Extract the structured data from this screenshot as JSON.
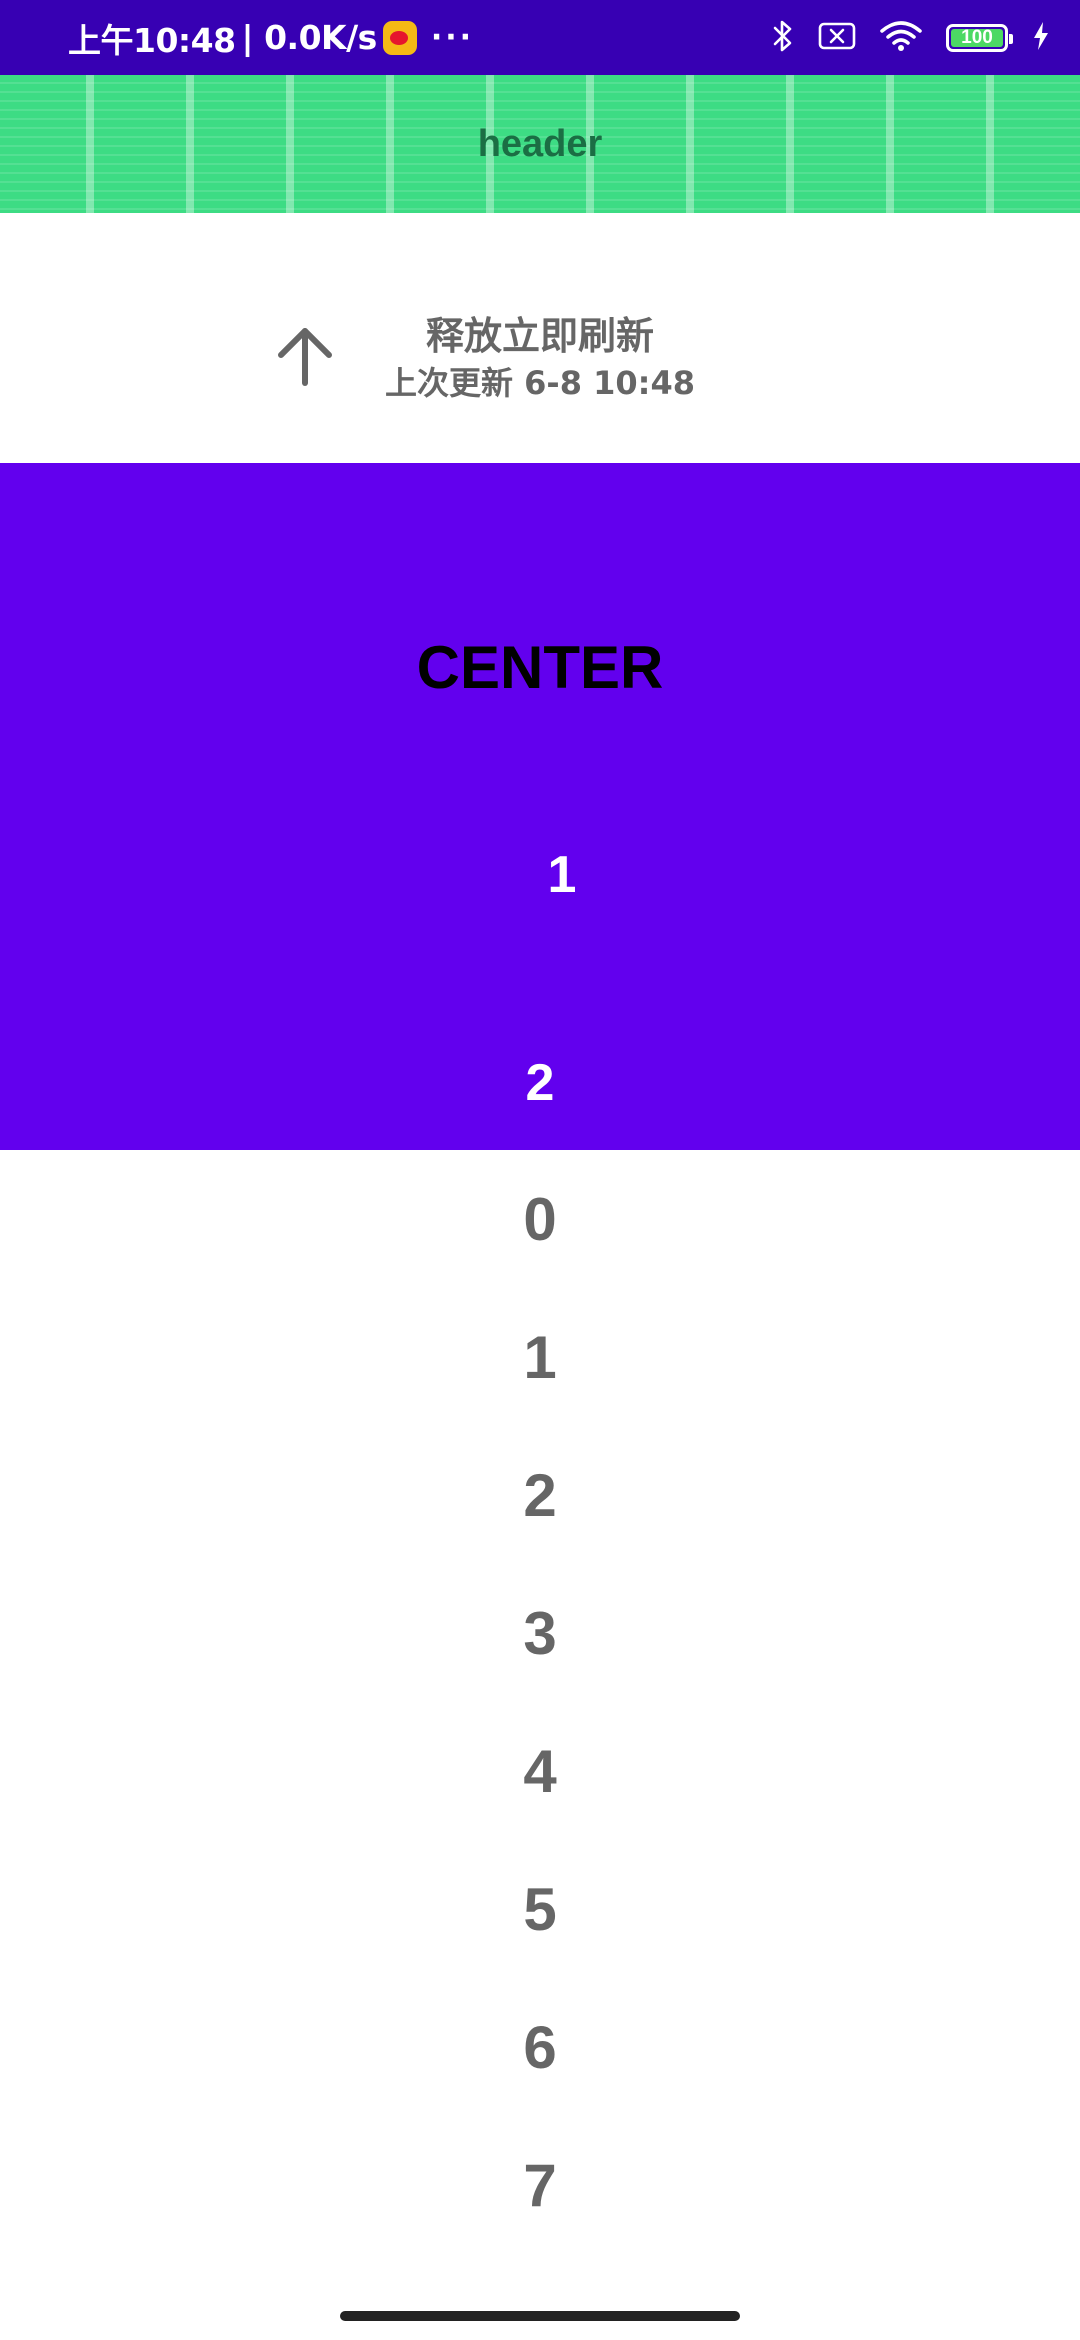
{
  "status_bar": {
    "time": "上午10:48",
    "network_speed": "| 0.0K/s",
    "app_icon": "weibo-icon",
    "more": "···",
    "icons": [
      "bluetooth-icon",
      "no-sim-icon",
      "wifi-icon",
      "battery-icon",
      "charging-icon"
    ],
    "battery_level": "100",
    "battery_fraction": 1.0,
    "background_color": "#3700b3"
  },
  "header": {
    "title": "header",
    "background_color": "#3ddc84"
  },
  "refresh_header": {
    "icon": "arrow-up-icon",
    "title": "释放立即刷新",
    "last_update": "上次更新 6-8 10:48"
  },
  "center_panel": {
    "label": "CENTER",
    "numbers": [
      "1",
      "2"
    ],
    "background_color": "#6200ee"
  },
  "list": {
    "items": [
      "0",
      "1",
      "2",
      "3",
      "4",
      "5",
      "6",
      "7"
    ]
  }
}
